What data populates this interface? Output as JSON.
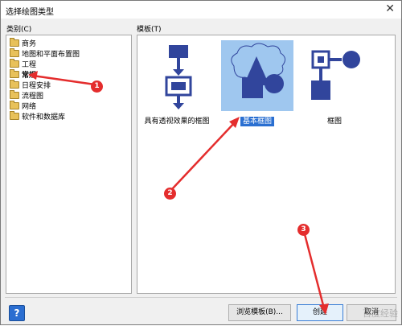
{
  "window": {
    "title": "选择绘图类型"
  },
  "categories": {
    "label": "类别(C)",
    "items": [
      "商务",
      "地图和平面布置图",
      "工程",
      "常规",
      "日程安排",
      "流程图",
      "网络",
      "软件和数据库"
    ],
    "selected": "常规"
  },
  "templates": {
    "label": "模板(T)",
    "items": [
      "具有透视效果的框图",
      "基本框图",
      "框图"
    ],
    "selected": "基本框图"
  },
  "buttons": {
    "help": "?",
    "browse": "浏览模板(B)...",
    "create": "创建",
    "cancel": "取消"
  },
  "annotations": [
    "1",
    "2",
    "3"
  ],
  "watermark": "百度经验",
  "colors": {
    "accent": "#2a6fd1",
    "shape": "#31459c",
    "marker": "#e42d2d"
  }
}
